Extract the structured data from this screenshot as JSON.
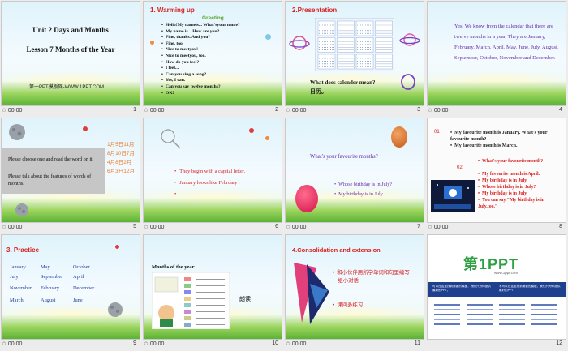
{
  "slides": [
    {
      "duration": "00:00",
      "number": "1",
      "title": "Unit 2 Days and Months",
      "subtitle": "Lesson 7  Months of the Year",
      "brand": "第一PPT模板网-WWW.1PPT.COM"
    },
    {
      "duration": "00:00",
      "number": "2",
      "title": "1. Warming  up",
      "subtitle": "Greeting",
      "lines": [
        "Hello!My nameis... What'syour name?",
        "My name is... How are you?",
        "Fine, thanks. And you?",
        "Fine, too.",
        "Nice to meetyou!",
        "Nice to meetyou, too.",
        "How do you feel?",
        "I feel...",
        "Can you sing a song?",
        "Yes, I can.",
        "Can you say twelve months?",
        "OK!"
      ]
    },
    {
      "duration": "00:00",
      "number": "3",
      "title": "2.Presentation",
      "question": "What does calender mean?",
      "answer": "日历。"
    },
    {
      "duration": "00:00",
      "number": "4",
      "text": "Yes. We know from the calendar that there are twelve months in a year. They are January, February, March, April, May, June, July, August, September, October, November and December."
    },
    {
      "duration": "00:00",
      "number": "5",
      "box_lines": [
        "Please choose one and read the word on it.",
        "Please talk about the features of words of months."
      ],
      "dates": [
        "1月5日11月",
        "8月10日7月",
        "4月8日2月",
        "6月3日12月"
      ]
    },
    {
      "duration": "00:00",
      "number": "6",
      "bullets": [
        "They begin with a capital letter.",
        "January looks like February .",
        "…"
      ]
    },
    {
      "duration": "00:00",
      "number": "7",
      "question": "What's your favourite months?",
      "bullets": [
        "Whose birthday is in July?",
        "My birthday  is in July."
      ]
    },
    {
      "duration": "00:00",
      "number": "8",
      "n1": "01",
      "n2": "02",
      "top_lines": [
        "My favourite month is January. What's your favourite month?",
        "My favourite month is March."
      ],
      "red_lines": [
        "What's your favourite month?",
        "My favourite month is April.",
        "My birthday is in July.",
        "Whose birthday is in July?",
        "My birthday  is in July.",
        "You can say \"My birthday is in July,too.\""
      ]
    },
    {
      "duration": "00:00",
      "number": "9",
      "title": "3. Practice",
      "months": [
        "January",
        "May",
        "October",
        "July",
        "September",
        "April",
        "November",
        "February",
        "December",
        "March",
        "August",
        "June"
      ]
    },
    {
      "duration": "00:00",
      "number": "10",
      "title": "Months of the year",
      "label": "朗读"
    },
    {
      "duration": "00:00",
      "number": "11",
      "title": "4.Consolidation and extension",
      "bullets": [
        "和小伙伴用所学单词和句型编写一组小对话",
        "课间多练习"
      ]
    },
    {
      "duration": "",
      "number": "12",
      "logo_main": "第1PPT",
      "logo_sub": "www.1ppt.com",
      "blue_left": "可以在这里找到需要的模板，我们只为你提供最好的PPT。",
      "blue_right": "不可以在这里找到需要的模板，我们只为你提供最好的PPT。"
    }
  ],
  "colors": {
    "red": "#d8201f",
    "purple": "#6a2ca6",
    "blue": "#2243a0"
  }
}
